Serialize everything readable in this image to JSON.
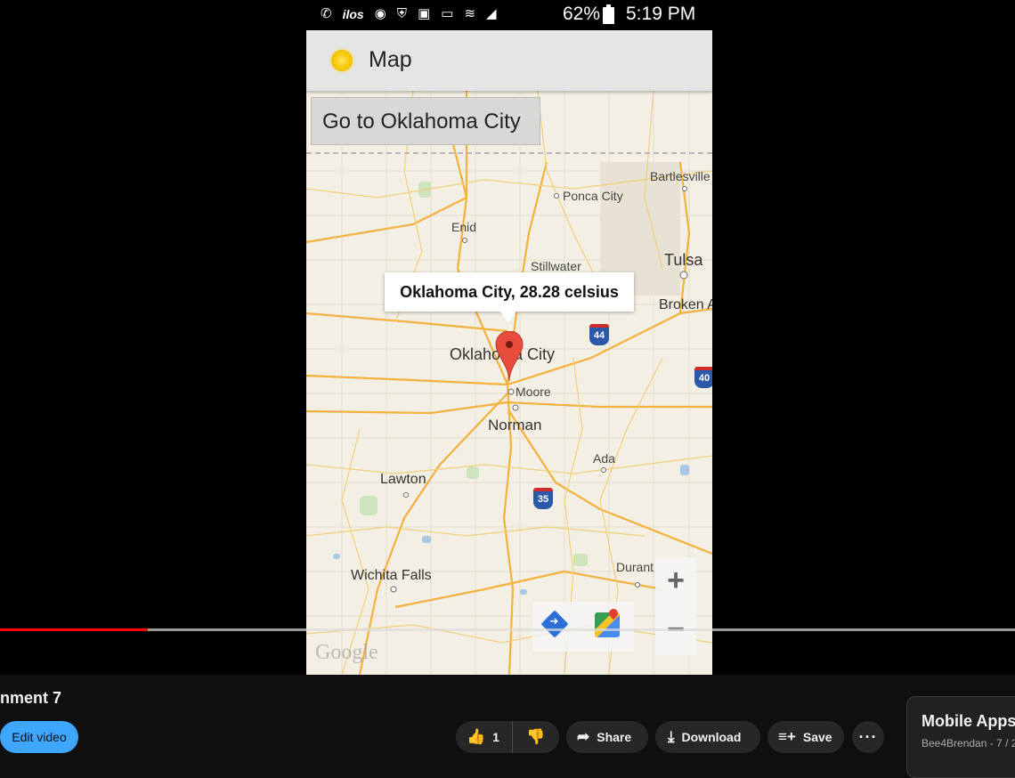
{
  "status_bar": {
    "icons": [
      "wifi-call-icon",
      "carrier-icon",
      "sync-icon",
      "shield-icon",
      "lock-icon",
      "cast-icon",
      "wifi-icon",
      "signal-icon"
    ],
    "carrier_label": "ilos",
    "battery_percent": "62%",
    "time": "5:19 PM"
  },
  "app": {
    "title": "Map",
    "goto_button_label": "Go to Oklahoma City"
  },
  "map": {
    "info_window": "Oklahoma City, 28.28 celsius",
    "cities": {
      "bartlesville": "Bartlesville",
      "ponca_city": "Ponca City",
      "enid": "Enid",
      "stillwater": "Stillwater",
      "tulsa": "Tulsa",
      "broken_arrow": "Broken A",
      "oklahoma_city": "Oklahoma City",
      "moore": "Moore",
      "norman": "Norman",
      "ada": "Ada",
      "lawton": "Lawton",
      "wichita_falls": "Wichita Falls",
      "durant": "Durant"
    },
    "highway_shields": {
      "i44": "44",
      "i40": "40",
      "i35": "35"
    },
    "zoom_in": "+",
    "zoom_out": "−",
    "attribution": "Google"
  },
  "player": {
    "progress_fraction": 0.146
  },
  "meta": {
    "title_partial": "nment 7",
    "edit_video_label": "Edit video",
    "like_count": "1",
    "share_label": "Share",
    "download_label": "Download",
    "save_label": "Save",
    "more_label": "···"
  },
  "playlist": {
    "title": "Mobile Apps",
    "subtitle": "Bee4Brendan - 7 / 2"
  },
  "colors": {
    "progress_played": "#ff0000",
    "edit_button": "#3ea6ff",
    "marker_red": "#e74c3c",
    "road_orange": "#f3b13e"
  }
}
